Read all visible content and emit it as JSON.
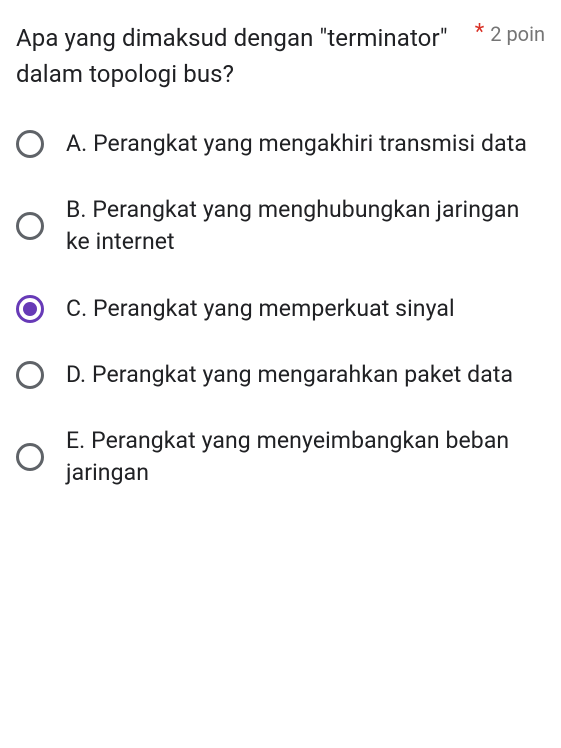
{
  "question": {
    "text": "Apa yang dimaksud dengan \"terminator\" dalam topologi bus?",
    "required_mark": "*",
    "points_label": "2 poin"
  },
  "options": [
    {
      "label": "A. Perangkat yang mengakhiri transmisi data",
      "selected": false
    },
    {
      "label": "B. Perangkat yang menghubungkan jaringan ke internet",
      "selected": false
    },
    {
      "label": "C. Perangkat yang memperkuat sinyal",
      "selected": true
    },
    {
      "label": "D. Perangkat yang mengarahkan paket data",
      "selected": false
    },
    {
      "label": "E. Perangkat yang menyeimbangkan beban jaringan",
      "selected": false
    }
  ]
}
